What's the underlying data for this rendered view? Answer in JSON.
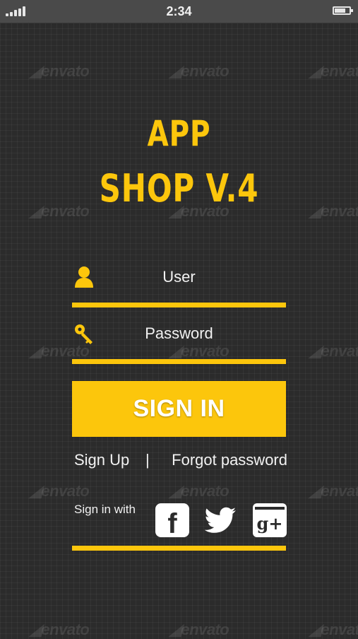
{
  "status_bar": {
    "time": "2:34"
  },
  "app": {
    "title_line1": "APP",
    "title_line2": "SHOP V.4"
  },
  "login": {
    "user_label": "User",
    "password_label": "Password",
    "sign_in_button": "SIGN IN",
    "sign_up_link": "Sign Up",
    "separator": "|",
    "forgot_password_link": "Forgot password",
    "sign_in_with_label": "Sign in with",
    "social": {
      "facebook_glyph": "f",
      "google_glyph": "g+"
    }
  },
  "watermark": {
    "text": "envato"
  },
  "colors": {
    "accent": "#fcc60c",
    "background": "#2b2b2b",
    "status_bar": "#4a4a4a",
    "text": "#f2f2f2"
  },
  "icons": [
    "signal-icon",
    "battery-icon",
    "user-icon",
    "key-icon",
    "facebook-icon",
    "twitter-icon",
    "google-plus-icon"
  ]
}
